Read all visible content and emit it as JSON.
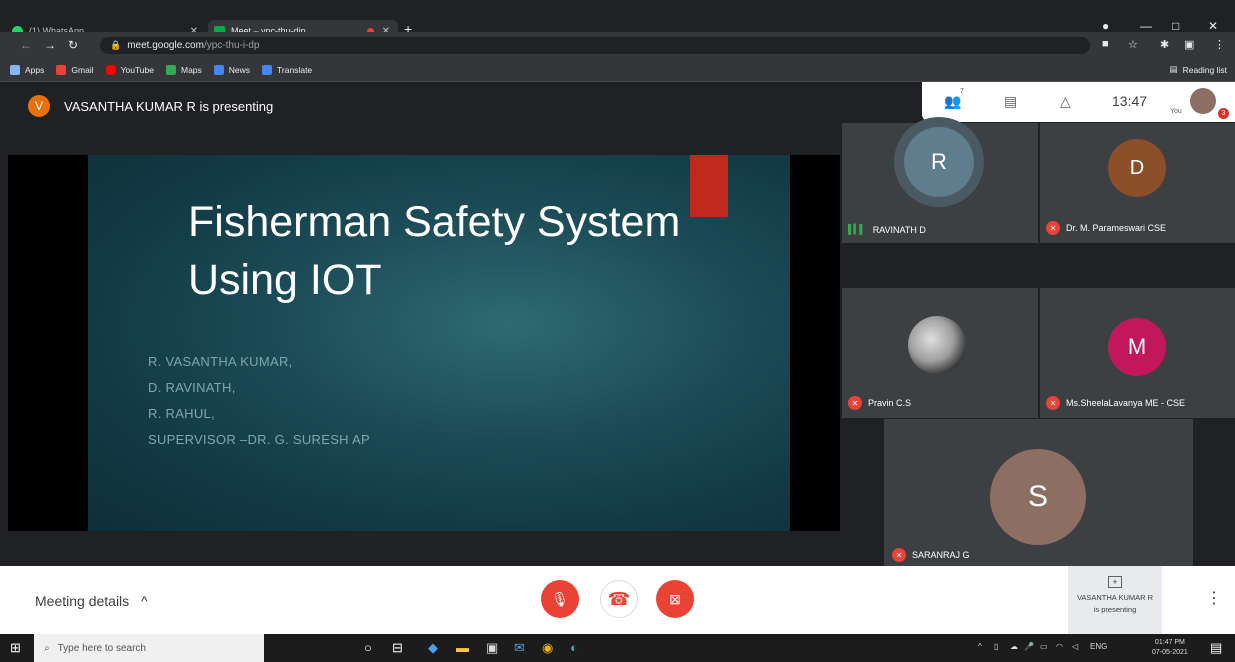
{
  "browser": {
    "tabs": [
      {
        "label": "(1) WhatsApp",
        "active": false
      },
      {
        "label": "Meet – ypc-thu-dip",
        "active": true
      }
    ],
    "new_tab": "+",
    "window_controls": [
      "—",
      "□",
      "✕"
    ],
    "url_host": "meet.google.com",
    "url_path": "/ypc-thu-i-dp",
    "bookmarks": [
      "Apps",
      "Gmail",
      "YouTube",
      "Maps",
      "News",
      "Translate"
    ],
    "reading_list": "Reading list"
  },
  "meet": {
    "presenter_initial": "V",
    "presenter_text": "VASANTHA KUMAR R is presenting",
    "clock": "13:47",
    "people_count": "7",
    "you_label": "You",
    "notification_badge": "3",
    "slide": {
      "title": "Fisherman Safety System Using IOT",
      "names": [
        "R. VASANTHA KUMAR,",
        "D. RAVINATH,",
        "R. RAHUL,",
        "SUPERVISOR –DR. G. SURESH AP"
      ]
    },
    "participants": [
      {
        "initial": "R",
        "name": "RAVINATH D",
        "color": "#5f7d8c",
        "muted": false
      },
      {
        "initial": "D",
        "name": "Dr. M. Parameswari CSE",
        "color": "#8d4e2a",
        "muted": true
      },
      {
        "initial": "",
        "name": "Pravin C.S",
        "color": "#9e9e9e",
        "muted": true
      },
      {
        "initial": "M",
        "name": "Ms.SheelaLavanya ME - CSE",
        "color": "#c2185b",
        "muted": true
      },
      {
        "initial": "S",
        "name": "SARANRAJ G",
        "color": "#8d6e63",
        "muted": true
      }
    ]
  },
  "controls": {
    "meeting_details": "Meeting details",
    "presenting_line1": "VASANTHA KUMAR R",
    "presenting_line2": "is presenting",
    "mic_color": "#ea4335",
    "end_color": "#ea4335",
    "cam_color": "#ea4335"
  },
  "taskbar": {
    "search_placeholder": "Type here to search",
    "lang": "ENG",
    "time": "01:47 PM",
    "date": "07-05-2021"
  }
}
